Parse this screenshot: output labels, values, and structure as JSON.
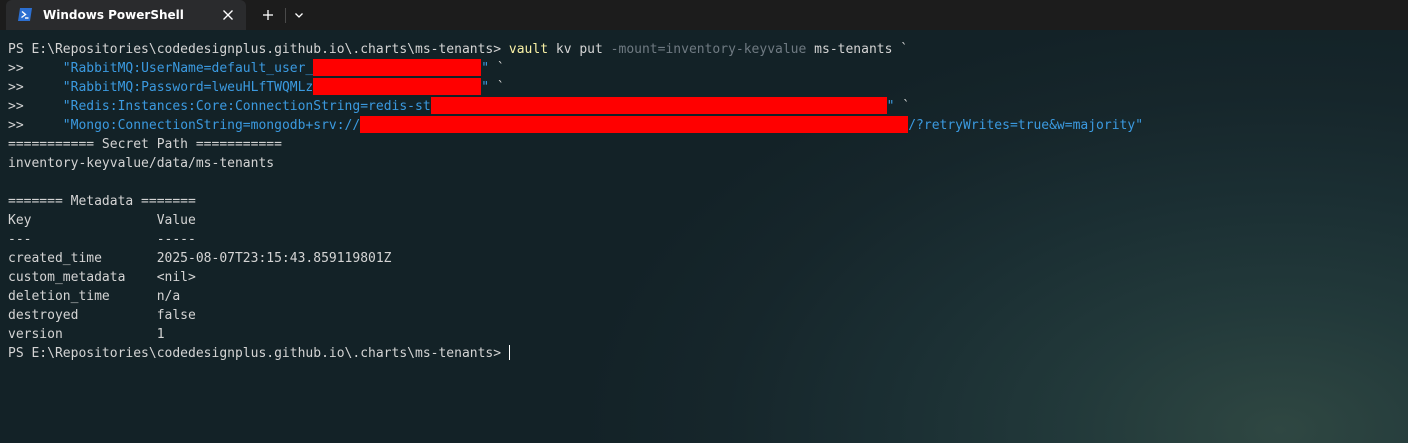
{
  "window": {
    "tab_title": "Windows PowerShell",
    "tab_icon": "powershell-icon",
    "close_icon": "close-icon",
    "new_tab_icon": "plus-icon",
    "dropdown_icon": "chevron-down-icon"
  },
  "colors": {
    "background": "#16262b",
    "tabbar": "#1c1c1c",
    "active_tab": "#2a2b2d",
    "command": "#f9f1a5",
    "parameter": "#6f7a82",
    "string": "#3b9ae0",
    "text": "#d4d4d4",
    "redaction": "#ff0000"
  },
  "terminal": {
    "command_line": {
      "prompt": "PS E:\\Repositories\\codedesignplus.github.io\\.charts\\ms-tenants> ",
      "cmd": "vault",
      "args": " kv put ",
      "param": "-mount=inventory-keyvalue",
      "target": " ms-tenants `"
    },
    "continuation": [
      {
        "prefix": ">>     ",
        "value": "\"RabbitMQ:UserName=default_user_",
        "suffix_quote": "\"",
        "suffix_tick": " `"
      },
      {
        "prefix": ">>     ",
        "value": "\"RabbitMQ:Password=lweuHLfTWQMLz",
        "suffix_quote": "\"",
        "suffix_tick": " `"
      },
      {
        "prefix": ">>     ",
        "value": "\"Redis:Instances:Core:ConnectionString=redis-st",
        "suffix_quote": "\"",
        "suffix_tick": " `"
      },
      {
        "prefix": ">>     ",
        "value": "\"Mongo:ConnectionString=mongodb+srv://",
        "suffix_quote": "/?retryWrites=true&w=majority\"",
        "suffix_tick": ""
      }
    ],
    "output": [
      "=========== Secret Path ===========",
      "inventory-keyvalue/data/ms-tenants",
      "",
      "======= Metadata =======",
      "Key                Value",
      "---                -----",
      "created_time       2025-08-07T23:15:43.859119801Z",
      "custom_metadata    <nil>",
      "deletion_time      n/a",
      "destroyed          false",
      "version            1"
    ],
    "final_prompt": "PS E:\\Repositories\\codedesignplus.github.io\\.charts\\ms-tenants>"
  }
}
